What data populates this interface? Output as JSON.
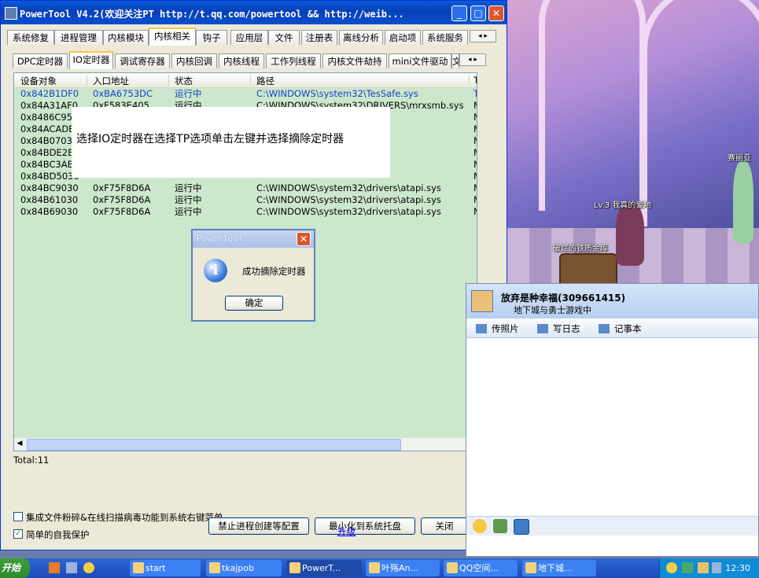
{
  "window": {
    "title": "PowerTool V4.2(欢迎关注PT http://t.qq.com/powertool && http://weib...",
    "minimize": "_",
    "maximize": "□",
    "close": "✕"
  },
  "main_tabs": [
    "系统修复",
    "进程管理",
    "内核模块",
    "内核相关",
    "钩子",
    "应用层",
    "文件",
    "注册表",
    "离线分析",
    "启动项",
    "系统服务"
  ],
  "main_tab_active": "内核相关",
  "sub_tabs": [
    "DPC定时器",
    "IO定时器",
    "调试寄存器",
    "内核回调",
    "内核线程",
    "工作列线程",
    "内核文件劫持",
    "mini文件驱动",
    "文"
  ],
  "sub_tab_active": "IO定时器",
  "tab_scroll": "◂ ▸",
  "columns": [
    "设备对象",
    "入口地址",
    "状态",
    "路径",
    "T"
  ],
  "rows": [
    {
      "device": "0x842B1DF0",
      "entry": "0xBA6753DC",
      "status": "运行中",
      "path": "C:\\WINDOWS\\system32\\TesSafe.sys",
      "extra": "T"
    },
    {
      "device": "0x84A31AF0",
      "entry": "0xF583E405",
      "status": "运行中",
      "path": "C:\\WINDOWS\\system32\\DRIVERS\\mrxsmb.sys",
      "extra": "M"
    },
    {
      "device": "0x8486C958",
      "entry": "",
      "status": "",
      "path": "RS\\rasacd.sys",
      "extra": "M"
    },
    {
      "device": "0x84ACADB",
      "entry": "",
      "status": "",
      "path": "RS\\portcls.sys",
      "extra": "M"
    },
    {
      "device": "0x84B0703C",
      "entry": "",
      "status": "",
      "path": "RS\\CLASSPNP....",
      "extra": "M"
    },
    {
      "device": "0x84BDE2B8",
      "entry": "",
      "status": "",
      "path": "RS\\Mup.sys",
      "extra": "M"
    },
    {
      "device": "0x84BC3AB8",
      "entry": "",
      "status": "",
      "path": "RS\\CLASSPNP....",
      "extra": "M"
    },
    {
      "device": "0x84BD5030",
      "entry": "",
      "status": "",
      "path": "",
      "extra": "M"
    },
    {
      "device": "0x84BC9030",
      "entry": "0xF75F8D6A",
      "status": "运行中",
      "path": "C:\\WINDOWS\\system32\\drivers\\atapi.sys",
      "extra": "M"
    },
    {
      "device": "0x84B61030",
      "entry": "0xF75F8D6A",
      "status": "运行中",
      "path": "C:\\WINDOWS\\system32\\drivers\\atapi.sys",
      "extra": "M"
    },
    {
      "device": "0x84B69030",
      "entry": "0xF75F8D6A",
      "status": "运行中",
      "path": "C:\\WINDOWS\\system32\\drivers\\atapi.sys",
      "extra": "M"
    }
  ],
  "overlay_note": "选择IO定时器在选择TP选项单击左键并选择摘除定时器",
  "total": "Total:11",
  "checkbox_shell": {
    "label": "集成文件粉碎&在线扫描病毒功能到系统右键菜单",
    "checked": false
  },
  "checkbox_selfprotect": {
    "label": "简单的自我保护",
    "checked": true
  },
  "buttons": {
    "block_process": "禁止进程创建等配置",
    "minimize_tray": "最小化到系统托盘",
    "close": "关闭"
  },
  "upgrade_link": "升级",
  "dialog": {
    "title": "PowerTool",
    "message": "成功摘除定时器",
    "ok": "确定",
    "icon": "info-icon"
  },
  "game": {
    "label_right": "赛丽亚",
    "label_level": "Lv.3 我真的爱地",
    "label_chest": "破烂的铁质金库"
  },
  "qq_panel": {
    "name": "放弃是种幸福(309661415)",
    "subtitle": "地下城与勇士游戏中",
    "tools": [
      "传照片",
      "写日志",
      "记事本"
    ]
  },
  "taskbar": {
    "start": "开始",
    "tasks": [
      "start",
      "tkajpob",
      "PowerT...",
      "叶殇An...",
      "QQ空间...",
      "地下城..."
    ],
    "active_task": "PowerT...",
    "clock": "12:30"
  },
  "colors": {
    "titlebar": "#0a5bd6",
    "list_bg": "#cce8cc",
    "selected_text": "#1a3cc8",
    "taskbar": "#245ac8"
  }
}
